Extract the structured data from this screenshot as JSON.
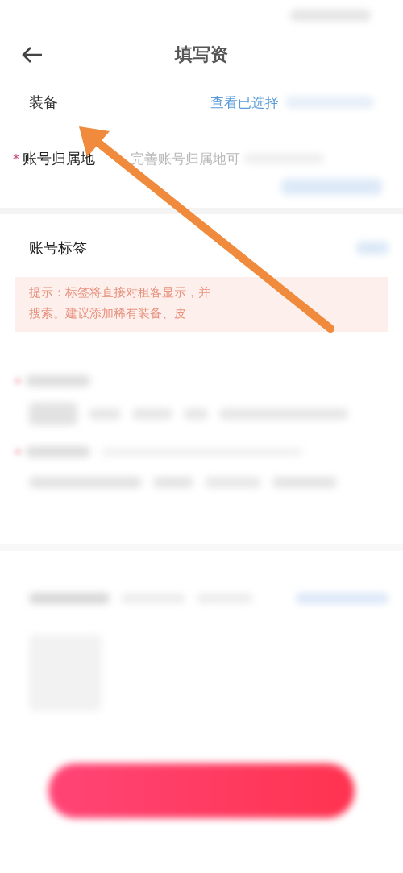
{
  "header": {
    "title": "填写资"
  },
  "equipment": {
    "label": "装备",
    "link": "查看已选择"
  },
  "account_region": {
    "required_mark": "*",
    "label": "账号归属地",
    "placeholder": "完善账号归属地可"
  },
  "account_tags": {
    "label": "账号标签",
    "hint_lines": [
      "提示：标签将直接对租客显示，并",
      "搜索。建议添加稀有装备、皮"
    ]
  }
}
